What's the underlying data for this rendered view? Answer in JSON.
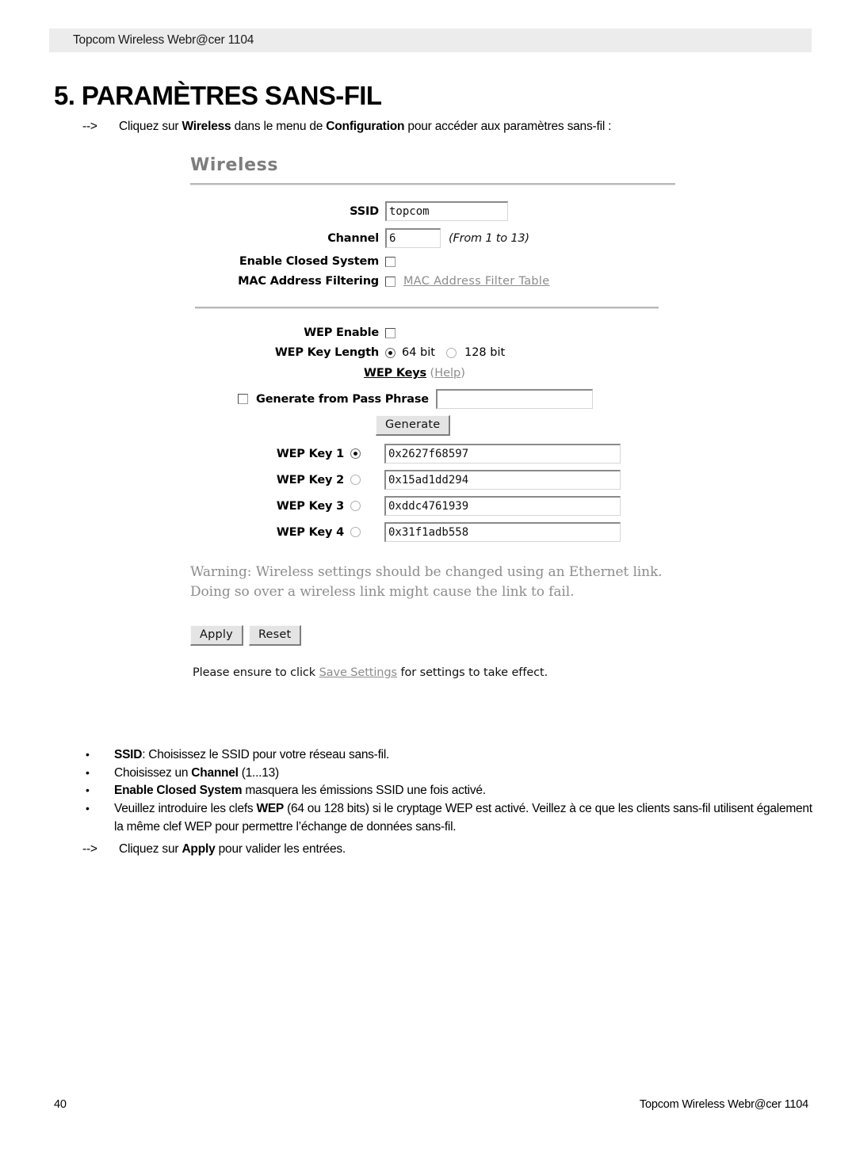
{
  "header": {
    "band_text": "Topcom Wireless Webr@cer 1104"
  },
  "title": "5. PARAMÈTRES SANS-FIL",
  "intro": {
    "arrow": "-->",
    "part1": "Cliquez sur ",
    "bold1": "Wireless",
    "part2": " dans le menu de ",
    "bold2": "Configuration",
    "part3": " pour accéder aux paramètres sans-fil :"
  },
  "router_ui": {
    "panel_title": "Wireless",
    "ssid": {
      "label": "SSID",
      "value": "topcom"
    },
    "channel": {
      "label": "Channel",
      "value": "6",
      "hint": "(From 1 to 13)"
    },
    "closed_system": {
      "label": "Enable Closed System",
      "checked": false
    },
    "mac_filtering": {
      "label": "MAC Address Filtering",
      "checked": false,
      "link": "MAC Address Filter Table"
    },
    "wep_enable": {
      "label": "WEP Enable",
      "checked": false
    },
    "wep_key_length": {
      "label": "WEP Key Length",
      "option_64": "64 bit",
      "option_128": "128 bit",
      "selected": "64 bit"
    },
    "wep_keys_heading": {
      "strong": "WEP Keys",
      "help_open": " (",
      "help": "Help",
      "help_close": ")"
    },
    "pass_phrase": {
      "label": "Generate from Pass Phrase",
      "value": "",
      "placeholder": "",
      "checked": false,
      "button": "Generate"
    },
    "wep_key_rows": [
      {
        "label": "WEP Key 1",
        "value": "0x2627f68597",
        "selected": true
      },
      {
        "label": "WEP Key 2",
        "value": "0x15ad1dd294",
        "selected": false
      },
      {
        "label": "WEP Key 3",
        "value": "0xddc4761939",
        "selected": false
      },
      {
        "label": "WEP Key 4",
        "value": "0x31f1adb558",
        "selected": false
      }
    ],
    "warning_line1": "Warning: Wireless settings should be changed using an Ethernet link.",
    "warning_line2": "Doing so over a wireless link might cause the link to fail.",
    "apply_button": "Apply",
    "reset_button": "Reset",
    "ensure": {
      "pre": "Please ensure to click ",
      "link": "Save Settings",
      "post": " for settings to take effect."
    }
  },
  "bullets": [
    {
      "dot": "•",
      "bold_lead": "SSID",
      "text": ": Choisissez le SSID pour votre réseau sans-fil."
    },
    {
      "dot": "•",
      "pre": "Choisissez un ",
      "bold_mid": "Channel",
      "text": " (1...13)"
    },
    {
      "dot": "•",
      "bold_lead": "Enable Closed System",
      "text": " masquera les émissions SSID une fois activé."
    },
    {
      "dot": "•",
      "pre": "Veuillez introduire les clefs ",
      "bold_mid": "WEP",
      "text": " (64 ou 128 bits) si le cryptage WEP est activé.  Veillez à ce que les clients sans-fil utilisent également la même clef WEP pour permettre l’échange de données sans-fil."
    }
  ],
  "closing": {
    "arrow": "-->",
    "pre": "Cliquez sur ",
    "bold": "Apply",
    "post": " pour valider les entrées."
  },
  "footer": {
    "page_number": "40",
    "right_text": "Topcom Wireless Webr@cer 1104"
  }
}
